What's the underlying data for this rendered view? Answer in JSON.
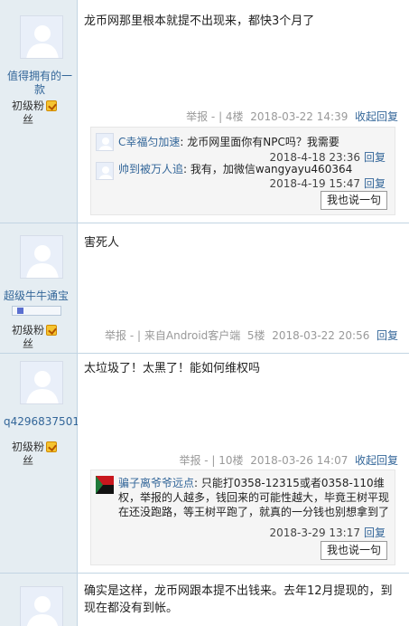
{
  "posts": [
    {
      "username_line1": "值得拥有的一",
      "username_line2": "款",
      "rank_line1": "初级粉",
      "rank_line2": "丝",
      "content": "龙币网那里根本就提不出现来，都快3个月了",
      "meta_report": "举报 -",
      "meta_floor": "| 4楼",
      "meta_date": "2018-03-22 14:39",
      "meta_collapse": "收起回复",
      "comments": [
        {
          "name": "C幸福匀加速",
          "text": ": 龙币网里面你有NPC吗？我需要",
          "time": "2018-4-18 23:36",
          "reply": "回复"
        },
        {
          "name": "帅到被万人追",
          "text": ": 我有，加微信wangyayu460364",
          "time": "2018-4-19 15:47",
          "reply": "回复"
        }
      ],
      "reply_button": "我也说一句"
    },
    {
      "username": "超级牛牛通宝",
      "rank_line1": "初级粉",
      "rank_line2": "丝",
      "content": "害死人",
      "meta_report": "举报 -",
      "meta_source": "| 来自Android客户端",
      "meta_floor": "5楼",
      "meta_date": "2018-03-22 20:56",
      "meta_reply": "回复"
    },
    {
      "username": "q4296837501",
      "rank_line1": "初级粉",
      "rank_line2": "丝",
      "content": "太垃圾了！太黑了！能如何维权吗",
      "meta_report": "举报 -",
      "meta_floor": "| 10楼",
      "meta_date": "2018-03-26 14:07",
      "meta_collapse": "收起回复",
      "comments": [
        {
          "name": "骗子离爷爷远点",
          "text": ": 只能打0358-12315或者0358-110维权，举报的人越多，钱回来的可能性越大，毕竟王树平现在还没跑路，等王树平跑了，就真的一分钱也别想拿到了",
          "time": "2018-3-29 13:17",
          "reply": "回复"
        }
      ],
      "reply_button": "我也说一句"
    },
    {
      "content": "确实是这样，龙币网跟本提不出钱来。去年12月提现的，到现在都没有到帐。"
    }
  ],
  "colors": {
    "author_bg": "#e5edf2",
    "link": "#336699",
    "comment_bg": "#f5f5f5",
    "muted": "#999999"
  },
  "icons": {
    "avatar": "default-avatar-icon",
    "medal": "rank-medal-icon",
    "badge": "mobile-badge-icon",
    "flag": "flag-avatar-icon"
  }
}
